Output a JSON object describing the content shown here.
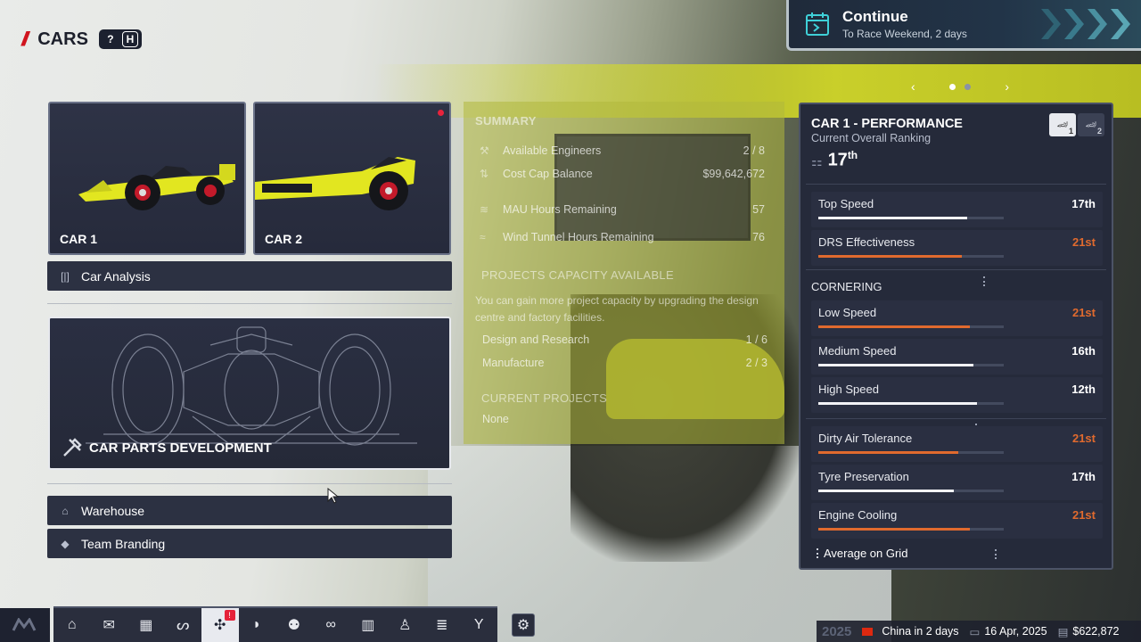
{
  "header": {
    "title": "CARS",
    "help_key": "?",
    "hotkey": "H"
  },
  "continue": {
    "title": "Continue",
    "subtitle": "To Race Weekend, 2 days"
  },
  "cars": [
    {
      "label": "CAR 1"
    },
    {
      "label": "CAR 2"
    }
  ],
  "menu": {
    "car_analysis": "Car Analysis",
    "car_parts_development": "CAR PARTS DEVELOPMENT",
    "warehouse": "Warehouse",
    "team_branding": "Team Branding"
  },
  "summary": {
    "title": "SUMMARY",
    "rows": [
      {
        "label": "Available Engineers",
        "value": "2 / 8",
        "icon": "engineer-icon"
      },
      {
        "label": "Cost Cap Balance",
        "value": "$99,642,672",
        "icon": "balance-icon"
      },
      {
        "label": "MAU Hours Remaining",
        "value": "57",
        "icon": "cfd-icon"
      },
      {
        "label": "Wind Tunnel Hours Remaining",
        "value": "76",
        "icon": "wind-icon"
      }
    ],
    "capacity_title": "PROJECTS CAPACITY AVAILABLE",
    "capacity_text": "You can gain more project capacity by upgrading the design centre and factory facilities.",
    "capacity_rows": [
      {
        "label": "Design and Research",
        "value": "1 / 6"
      },
      {
        "label": "Manufacture",
        "value": "2 / 3"
      }
    ],
    "current_title": "CURRENT PROJECTS",
    "current_value": "None"
  },
  "performance": {
    "title": "CAR 1 - PERFORMANCE",
    "subtitle": "Current Overall Ranking",
    "rank": "17",
    "rank_suffix": "th",
    "toggle": [
      "1",
      "2"
    ],
    "stats_top": [
      {
        "name": "Top Speed",
        "value": "17th",
        "color": "white",
        "fill": 0.89,
        "avg": 0.96
      },
      {
        "name": "DRS Effectiveness",
        "value": "21st",
        "color": "orange",
        "fill": 0.86,
        "avg": 0.99
      }
    ],
    "cornering_label": "CORNERING",
    "stats_corner": [
      {
        "name": "Low Speed",
        "value": "21st",
        "color": "orange",
        "fill": 0.91,
        "avg": 0.99
      },
      {
        "name": "Medium Speed",
        "value": "16th",
        "color": "white",
        "fill": 0.93,
        "avg": 0.97
      },
      {
        "name": "High Speed",
        "value": "12th",
        "color": "white",
        "fill": 0.95,
        "avg": 0.94
      }
    ],
    "stats_bottom": [
      {
        "name": "Dirty Air Tolerance",
        "value": "21st",
        "color": "orange",
        "fill": 0.84,
        "avg": 1.0
      },
      {
        "name": "Tyre Preservation",
        "value": "17th",
        "color": "white",
        "fill": 0.81,
        "avg": 0.92
      },
      {
        "name": "Engine Cooling",
        "value": "21st",
        "color": "orange",
        "fill": 0.91,
        "avg": 1.06
      }
    ],
    "legend": "Average on Grid"
  },
  "status": {
    "year": "2025",
    "race": "China in 2 days",
    "date": "16 Apr, 2025",
    "money": "$622,872"
  },
  "dock": [
    "home-icon",
    "mail-icon",
    "calendar-icon",
    "track-icon",
    "car-icon",
    "helmet-icon",
    "staff-icon",
    "scouting-icon",
    "facilities-icon",
    "sponsors-icon",
    "finance-icon",
    "trophy-icon"
  ],
  "dock_badge": "!",
  "colors": {
    "accent_red": "#d0141e",
    "orange": "#e06a2e",
    "panel": "#252a3a"
  }
}
